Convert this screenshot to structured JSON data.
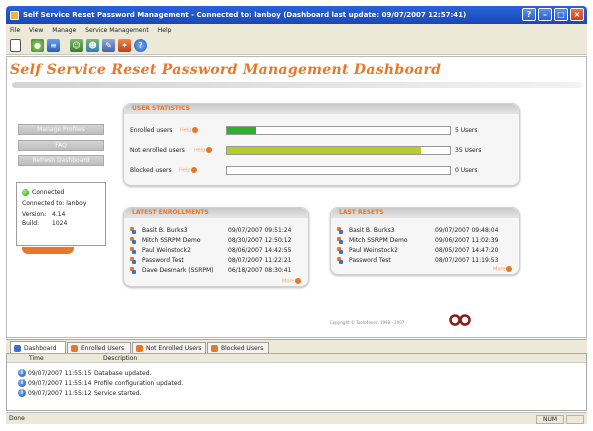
{
  "window": {
    "title": "Self Service Reset Password Management - Connected to: lanboy (Dashboard last update: 09/07/2007 12:57:41)",
    "buttons": [
      "help-button",
      "minimize",
      "maximize",
      "close"
    ]
  },
  "menu": [
    "File",
    "View",
    "Manage",
    "Service Management",
    "Help"
  ],
  "toolbar": [
    "new-icon",
    "users-icon",
    "database-icon",
    "users-group-icon",
    "users-add-icon",
    "tools-icon",
    "security-icon",
    "help-icon"
  ],
  "dashboard": {
    "title": "Self Service Reset Password Management Dashboard"
  },
  "sidebar": {
    "buttons": [
      "Manage Profiles",
      "FAQ",
      "Refresh Dashboard"
    ],
    "status": "Connected",
    "connected_to_label": "Connected to:",
    "connected_to": "lanboy",
    "version_label": "Version:",
    "version": "4.14",
    "build_label": "Build:",
    "build": "1024"
  },
  "user_stats": {
    "title": "USER STATISTICS",
    "help_label": "Help",
    "rows": [
      {
        "label": "Enrolled users",
        "count": "5 Users",
        "fill": 0.13,
        "color": "#2fb02a"
      },
      {
        "label": "Not enrolled users",
        "count": "35 Users",
        "fill": 0.87,
        "color": "#b8cc2c"
      },
      {
        "label": "Blocked users",
        "count": "0 Users",
        "fill": 0.0,
        "color": "#e8772a"
      }
    ]
  },
  "latest_enrollments": {
    "title": "LATEST ENROLLMENTS",
    "more_label": "More",
    "rows": [
      {
        "name": "Basit B. Burks3",
        "time": "09/07/2007 09:51:24"
      },
      {
        "name": "Mitch SSRPM Demo",
        "time": "08/30/2007 12:50:12"
      },
      {
        "name": "Paul Weinstock2",
        "time": "08/06/2007 14:42:55"
      },
      {
        "name": "Password Test",
        "time": "08/07/2007 11:22:21"
      },
      {
        "name": "Dave Desmark (SSRPM)",
        "time": "06/18/2007 08:30:41"
      }
    ]
  },
  "latest_resets": {
    "title": "LAST RESETS",
    "more_label": "More",
    "rows": [
      {
        "name": "Basit B. Burks3",
        "time": "09/07/2007 09:48:04"
      },
      {
        "name": "Mitch SSRPM Demo",
        "time": "09/06/2007 11:02:39"
      },
      {
        "name": "Paul Weinstock2",
        "time": "08/05/2007 14:47:20"
      },
      {
        "name": "Password Test",
        "time": "08/07/2007 11:19:53"
      }
    ]
  },
  "copyright": "Copyright © Tools4ever, 1998 - 2007",
  "tabs": [
    {
      "label": "Dashboard",
      "color": "#3a72c9"
    },
    {
      "label": "Enrolled Users",
      "color": "#e8772a"
    },
    {
      "label": "Not Enrolled Users",
      "color": "#e8772a"
    },
    {
      "label": "Blocked Users",
      "color": "#e8772a"
    }
  ],
  "log": {
    "columns": [
      "Time",
      "Description"
    ],
    "rows": [
      {
        "time": "09/07/2007 11:55:15",
        "desc": "Database updated."
      },
      {
        "time": "09/07/2007 11:55:14",
        "desc": "Profile configuration updated."
      },
      {
        "time": "09/07/2007 11:55:12",
        "desc": "Service started."
      }
    ]
  },
  "statusbar": {
    "left": "Done",
    "right": "NUM"
  }
}
